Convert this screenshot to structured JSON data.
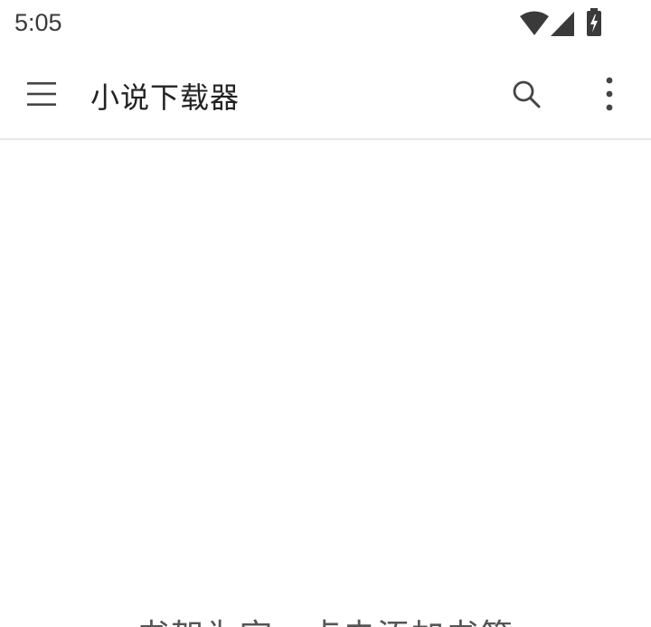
{
  "status_bar": {
    "time": "5:05",
    "icons": [
      "wifi-icon",
      "cellular-signal-icon",
      "battery-charging-icon"
    ]
  },
  "app_bar": {
    "menu_icon": "menu-icon",
    "title": "小说下载器",
    "search_icon": "search-icon",
    "more_icon": "more-vert-icon"
  },
  "main": {
    "empty_hint": "书架为空，点击添加书签"
  },
  "colors": {
    "background": "#ffffff",
    "text_primary": "#222222",
    "text_secondary": "#555555",
    "icon": "#444444",
    "divider": "#e8e8e8"
  }
}
